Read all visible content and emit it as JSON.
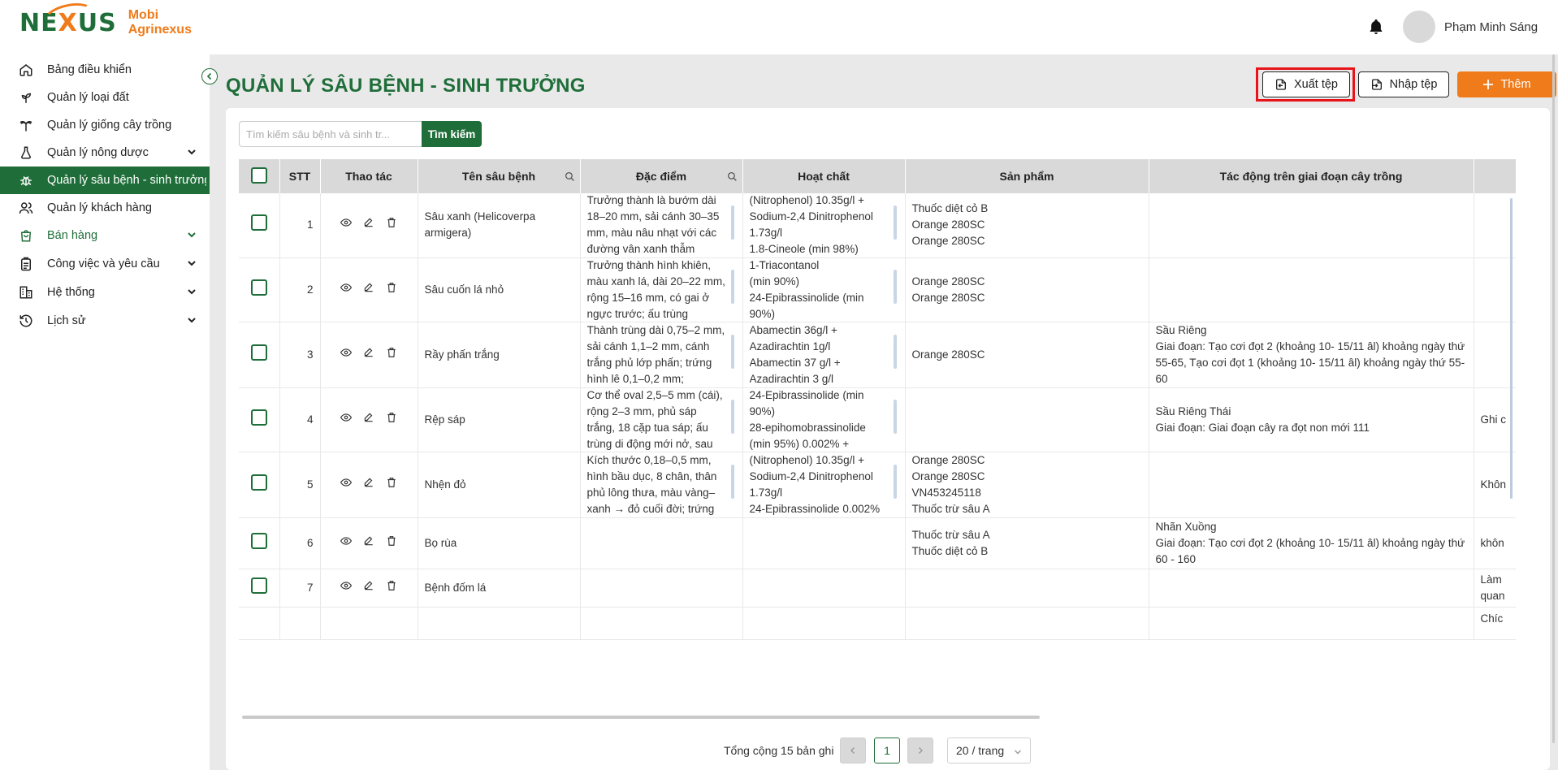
{
  "brand": {
    "logo_text": "NEXUS",
    "line1": "Mobi",
    "line2": "Agrinexus"
  },
  "header": {
    "username": "Phạm Minh Sáng"
  },
  "sidebar": {
    "items": [
      {
        "label": "Bảng điều khiển",
        "icon": "home-icon"
      },
      {
        "label": "Quản lý loại đất",
        "icon": "sprout-icon"
      },
      {
        "label": "Quản lý giống cây trồng",
        "icon": "palm-tree-icon"
      },
      {
        "label": "Quản lý nông dược",
        "icon": "flask-icon",
        "expandable": true
      },
      {
        "label": "Quản lý sâu bệnh - sinh trưởng",
        "icon": "bug-icon",
        "active": true
      },
      {
        "label": "Quản lý khách hàng",
        "icon": "users-icon"
      },
      {
        "label": "Bán hàng",
        "icon": "shopping-bag-icon",
        "expandable": true
      },
      {
        "label": "Công việc và yêu cầu",
        "icon": "clipboard-icon",
        "expandable": true
      },
      {
        "label": "Hệ thống",
        "icon": "building-icon",
        "expandable": true
      },
      {
        "label": "Lịch sử",
        "icon": "history-icon",
        "expandable": true
      }
    ]
  },
  "page": {
    "title": "QUẢN LÝ SÂU BỆNH - SINH TRƯỞNG"
  },
  "toolbar": {
    "export_label": "Xuất tệp",
    "import_label": "Nhập tệp",
    "add_label": "Thêm"
  },
  "search": {
    "placeholder": "Tìm kiếm sâu bệnh và sinh tr...",
    "button_label": "Tìm kiếm"
  },
  "table": {
    "columns": [
      "STT",
      "Thao tác",
      "Tên sâu bệnh",
      "Đặc điểm",
      "Hoạt chất",
      "Sản phẩm",
      "Tác động trên giai đoạn cây trồng"
    ],
    "rows": [
      {
        "stt": "1",
        "name": "Sâu xanh (Helicoverpa armigera)",
        "feature": "Trưởng thành là bướm dài 18–20 mm, sải cánh 30–35 mm, màu nâu nhạt với các đường vân xanh thẫm",
        "active": "(Nitrophenol) 10.35g/l +\nSodium-2,4 Dinitrophenol 1.73g/l\n1.8-Cineole (min 98%)",
        "product": "Thuốc diệt cỏ B\nOrange 280SC\nOrange 280SC",
        "impact": "",
        "extra": ""
      },
      {
        "stt": "2",
        "name": "Sâu cuốn lá nhỏ",
        "feature": "Trưởng thành hình khiên, màu xanh lá, dài 20–22 mm, rộng 15–16 mm, có gai ở ngực trước; ấu trùng",
        "active": "1-Triacontanol\n(min 90%)\n24-Epibrassinolide (min 90%)",
        "product": "Orange 280SC\nOrange 280SC",
        "impact": "",
        "extra": ""
      },
      {
        "stt": "3",
        "name": "Rầy phấn trắng",
        "feature": "Thành trùng dài 0,75–2 mm, sải cánh 1,1–2 mm, cánh trắng phủ lớp phấn; trứng hình lê 0,1–0,2 mm;",
        "active": "Abamectin 36g/l +\nAzadirachtin 1g/l\nAbamectin 37 g/l +\nAzadirachtin 3 g/l",
        "product": "Orange 280SC",
        "impact": "Sầu Riêng\nGiai đoạn: Tạo cơi đọt 2 (khoảng 10- 15/11 âl) khoảng ngày thứ 55-65, Tạo cơi đọt 1 (khoảng 10- 15/11 âl) khoảng ngày thứ 55-60",
        "extra": ""
      },
      {
        "stt": "4",
        "name": "Rệp sáp",
        "feature": "Cơ thể oval 2,5–5 mm (cái), rộng 2–3 mm, phủ sáp trắng, 18 cặp tua sáp; ấu trùng di động mới nở, sau",
        "active": "24-Epibrassinolide (min 90%)\n28-epihomobrassinolide (min 95%) 0.002% +",
        "product": "",
        "impact": "Sầu Riêng Thái\nGiai đoạn: Giai đoạn cây ra đọt non mới 111",
        "extra": "Ghi c"
      },
      {
        "stt": "5",
        "name": "Nhện đỏ",
        "feature": "Kích thước 0,18–0,5 mm, hình bầu dục, 8 chân, thân phủ lông thưa, màu vàng–xanh → đỏ cuối đời; trứng",
        "active": "(Nitrophenol) 10.35g/l +\nSodium-2,4 Dinitrophenol 1.73g/l\n24-Epibrassinolide 0.002%",
        "product": "Orange 280SC\nOrange 280SC\nVN453245118\nThuốc trừ sâu A",
        "impact": "",
        "extra": "Khôn"
      },
      {
        "stt": "6",
        "name": "Bọ rùa",
        "feature": "",
        "active": "",
        "product": "Thuốc trừ sâu A\nThuốc diệt cỏ B",
        "impact": "Nhãn Xuồng\nGiai đoạn: Tạo cơi đọt 2 (khoảng 10- 15/11 âl) khoảng ngày thứ 60 - 160",
        "extra": "khôn"
      },
      {
        "stt": "7",
        "name": "Bệnh đốm lá",
        "feature": "",
        "active": "",
        "product": "",
        "impact": "",
        "extra": "Làm\nquan"
      }
    ],
    "partial_row_extra": "Chíc"
  },
  "pagination": {
    "total_label": "Tổng cộng 15 bản ghi",
    "current_page": "1",
    "page_size": "20 / trang"
  },
  "colors": {
    "primary": "#1f6e3a",
    "accent": "#f07b1a",
    "highlight": "#e8141a"
  }
}
